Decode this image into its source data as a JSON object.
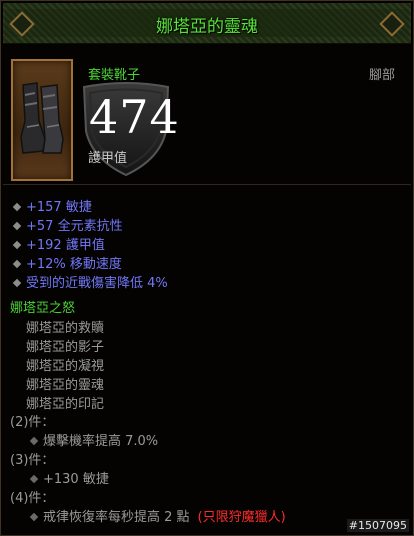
{
  "item": {
    "name": "娜塔亞的靈魂",
    "type": "套裝靴子",
    "slot": "腳部",
    "armor_value": "474",
    "armor_label": "護甲值"
  },
  "stats": [
    "+157 敏捷",
    "+57 全元素抗性",
    "+192 護甲值",
    "+12% 移動速度",
    "受到的近戰傷害降低 4%"
  ],
  "set": {
    "name": "娜塔亞之怒",
    "items": [
      "娜塔亞的救贖",
      "娜塔亞的影子",
      "娜塔亞的凝視",
      "娜塔亞的靈魂",
      "娜塔亞的印記"
    ],
    "bonuses": [
      {
        "label": "(2)件：",
        "text": "爆擊機率提高 7.0%"
      },
      {
        "label": "(3)件：",
        "text": "+130 敏捷"
      },
      {
        "label": "(4)件：",
        "text": "戒律恢復率每秒提高 2 點",
        "restriction": "(只限狩魔獵人)"
      }
    ]
  },
  "watermark": "#1507095",
  "colors": {
    "title_green": "#58e33a",
    "stat_blue": "#7177f7",
    "set_gray": "#9a9a9a",
    "restriction_red": "#ff2a2a"
  },
  "icons": {
    "item": "boots-icon",
    "armor": "shield-icon"
  }
}
